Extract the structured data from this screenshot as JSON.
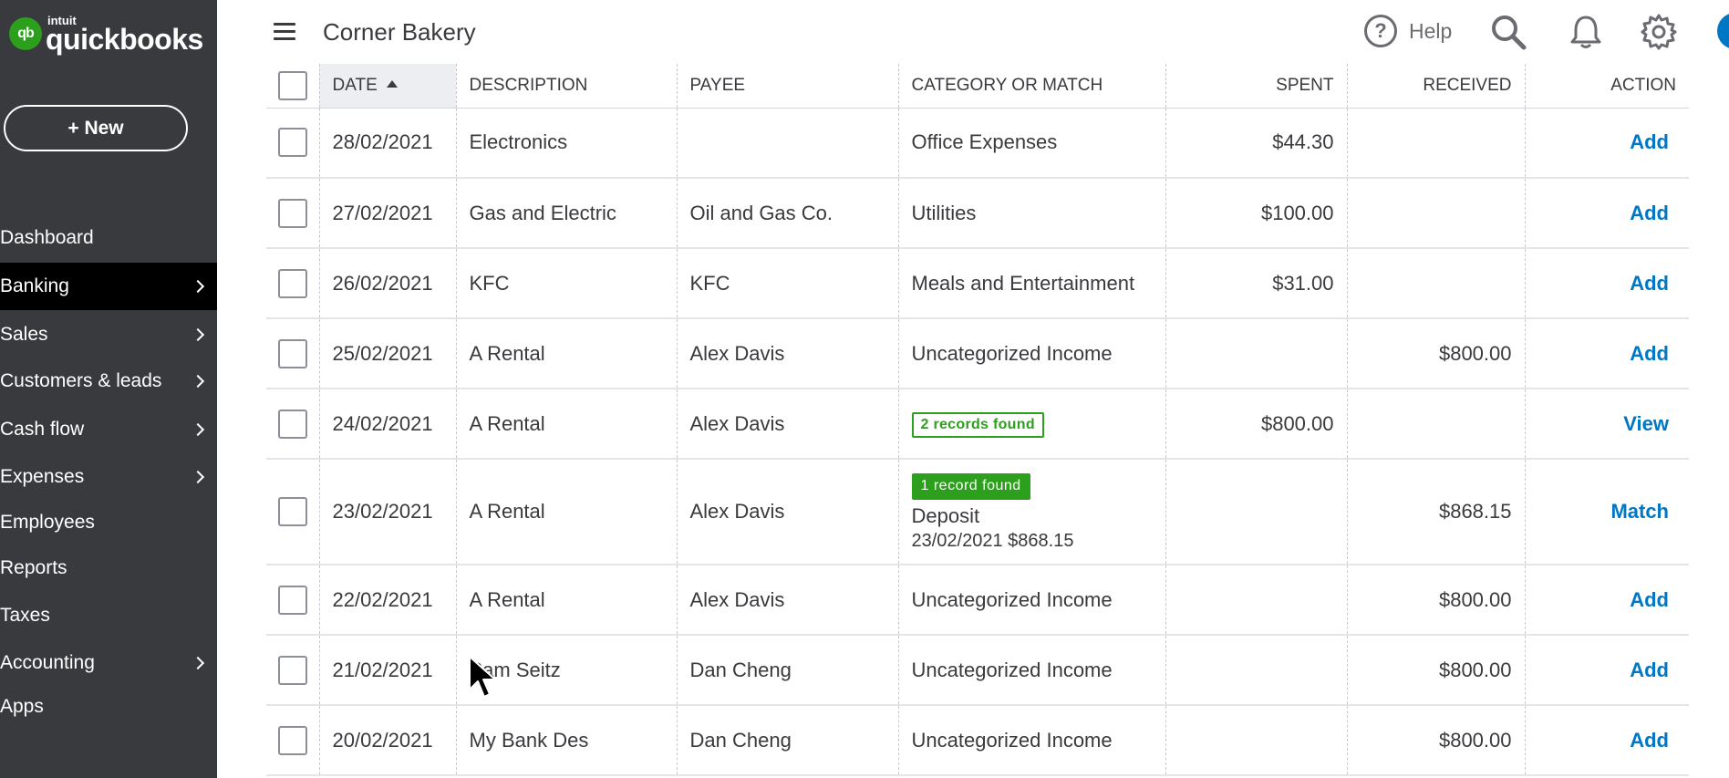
{
  "app": {
    "brand_small": "intuit",
    "brand": "quickbooks",
    "logo_mark": "qb"
  },
  "sidebar": {
    "new_button": "+ New",
    "items": [
      {
        "label": "Dashboard",
        "chevron": false,
        "active": false
      },
      {
        "label": "Banking",
        "chevron": true,
        "active": true
      },
      {
        "label": "Sales",
        "chevron": true,
        "active": false
      },
      {
        "label": "Customers & leads",
        "chevron": true,
        "active": false
      },
      {
        "label": "Cash flow",
        "chevron": true,
        "active": false
      },
      {
        "label": "Expenses",
        "chevron": true,
        "active": false
      },
      {
        "label": "Employees",
        "chevron": false,
        "active": false
      },
      {
        "label": "Reports",
        "chevron": false,
        "active": false
      },
      {
        "label": "Taxes",
        "chevron": false,
        "active": false
      },
      {
        "label": "Accounting",
        "chevron": true,
        "active": false
      },
      {
        "label": "Apps",
        "chevron": false,
        "active": false
      }
    ]
  },
  "header": {
    "company": "Corner Bakery",
    "help_label": "Help",
    "help_glyph": "?",
    "icons": [
      "menu-icon",
      "help-icon",
      "search-icon",
      "bell-icon",
      "gear-icon",
      "user-avatar"
    ]
  },
  "table": {
    "columns": {
      "date": "DATE",
      "description": "DESCRIPTION",
      "payee": "PAYEE",
      "category": "CATEGORY OR MATCH",
      "spent": "SPENT",
      "received": "RECEIVED",
      "action": "ACTION"
    },
    "rows": [
      {
        "date": "28/02/2021",
        "description": "Electronics",
        "payee": "",
        "category": "Office Expenses",
        "spent": "$44.30",
        "received": "",
        "action": "Add"
      },
      {
        "date": "27/02/2021",
        "description": "Gas and Electric",
        "payee": "Oil and Gas Co.",
        "category": "Utilities",
        "spent": "$100.00",
        "received": "",
        "action": "Add"
      },
      {
        "date": "26/02/2021",
        "description": "KFC",
        "payee": "KFC",
        "category": "Meals and Entertainment",
        "spent": "$31.00",
        "received": "",
        "action": "Add"
      },
      {
        "date": "25/02/2021",
        "description": "A Rental",
        "payee": "Alex Davis",
        "category": "Uncategorized Income",
        "spent": "",
        "received": "$800.00",
        "action": "Add"
      },
      {
        "date": "24/02/2021",
        "description": "A Rental",
        "payee": "Alex Davis",
        "badge": "2 records found",
        "spent": "$800.00",
        "received": "",
        "action": "View"
      },
      {
        "date": "23/02/2021",
        "description": "A Rental",
        "payee": "Alex Davis",
        "match_badge": "1 record found",
        "match_title": "Deposit",
        "match_sub": "23/02/2021 $868.15",
        "spent": "",
        "received": "$868.15",
        "action": "Match"
      },
      {
        "date": "22/02/2021",
        "description": "A Rental",
        "payee": "Alex Davis",
        "category": "Uncategorized Income",
        "spent": "",
        "received": "$800.00",
        "action": "Add"
      },
      {
        "date": "21/02/2021",
        "description": "Pam Seitz",
        "payee": "Dan Cheng",
        "category": "Uncategorized Income",
        "spent": "",
        "received": "$800.00",
        "action": "Add"
      },
      {
        "date": "20/02/2021",
        "description": "My Bank Des",
        "payee": "Dan Cheng",
        "category": "Uncategorized Income",
        "spent": "",
        "received": "$800.00",
        "action": "Add"
      }
    ]
  },
  "colors": {
    "sidebar_bg": "#393a3d",
    "active_nav_bg": "#000000",
    "brand_green": "#2ca01c",
    "link_blue": "#0077c5"
  }
}
